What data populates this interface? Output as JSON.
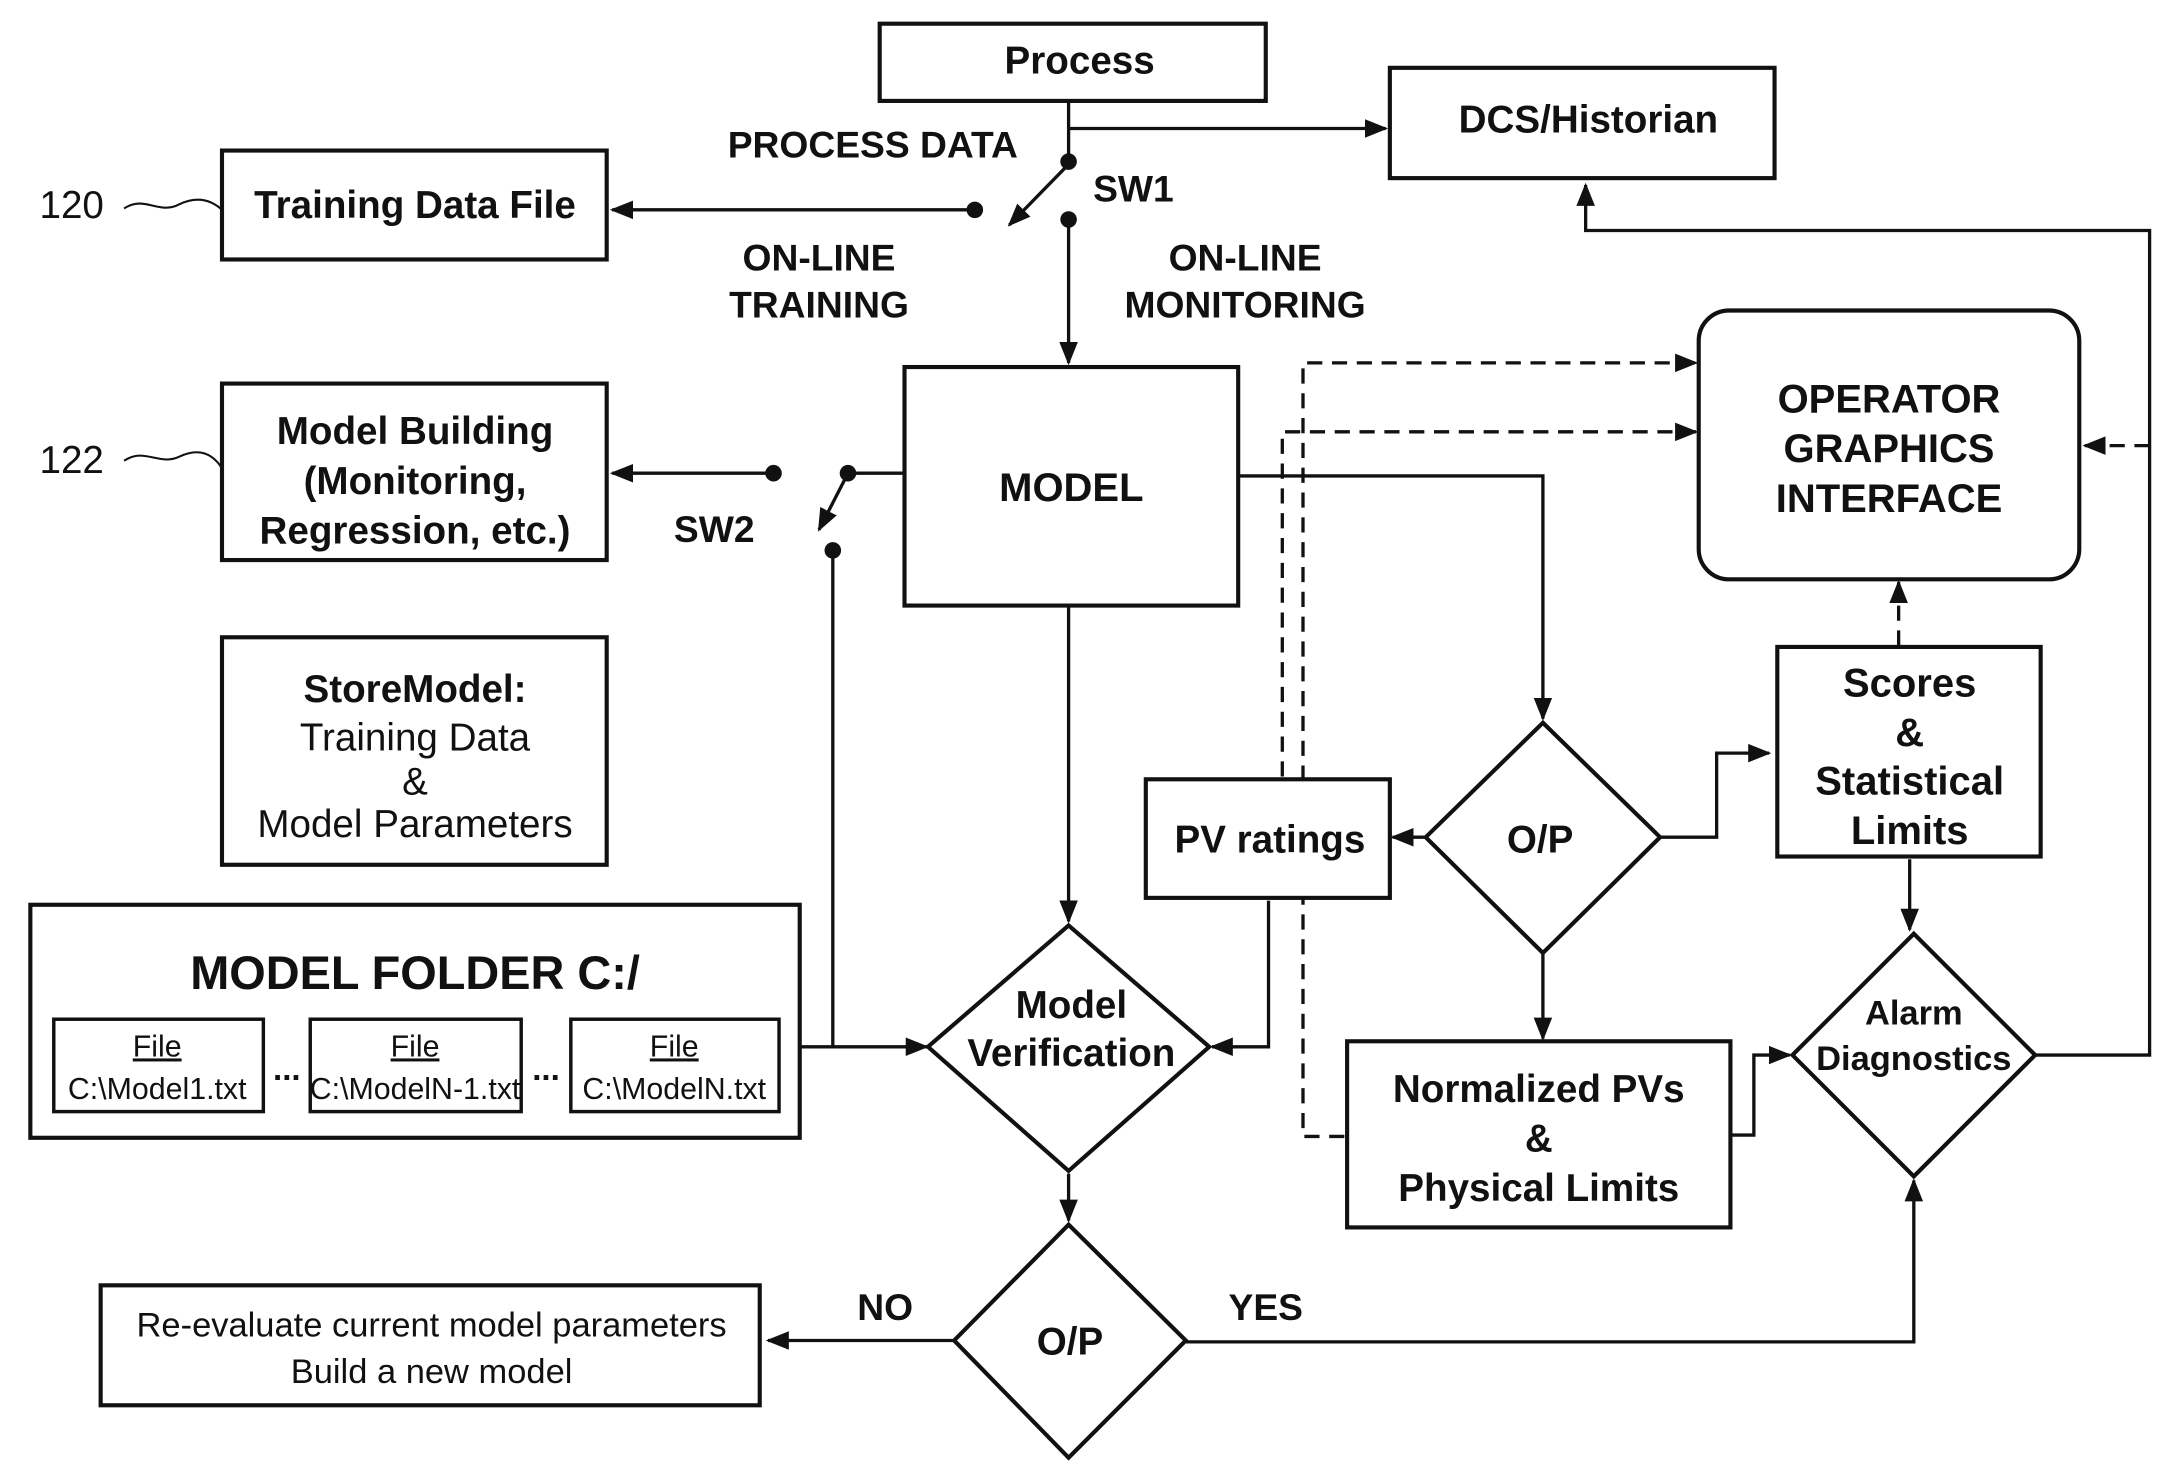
{
  "diagram": {
    "ref_labels": {
      "training_data_file": "120",
      "model_building": "122"
    },
    "process": "Process",
    "process_data_label": "PROCESS DATA",
    "dcs_historian": "DCS/Historian",
    "switch1": "SW1",
    "switch2": "SW2",
    "online_training": [
      "ON-LINE",
      "TRAINING"
    ],
    "online_monitoring": [
      "ON-LINE",
      "MONITORING"
    ],
    "training_data_file": "Training Data File",
    "model_building": [
      "Model Building",
      "(Monitoring,",
      "Regression, etc.)"
    ],
    "store_model": {
      "title": "StoreModel:",
      "lines": [
        "Training Data",
        "&",
        "Model Parameters"
      ]
    },
    "model": "MODEL",
    "operator_interface": [
      "OPERATOR",
      "GRAPHICS",
      "INTERFACE"
    ],
    "model_folder": {
      "title": "MODEL FOLDER C:/",
      "files": [
        {
          "label": "File",
          "path": "C:\\Model1.txt"
        },
        {
          "label": "File",
          "path": "C:\\ModelN-1.txt"
        },
        {
          "label": "File",
          "path": "C:\\ModelN.txt"
        }
      ],
      "ellipsis": "..."
    },
    "model_verification": [
      "Model",
      "Verification"
    ],
    "pv_ratings": "PV ratings",
    "op_decision_top": "O/P",
    "scores_limits": [
      "Scores",
      "&",
      "Statistical",
      "Limits"
    ],
    "normalized_pvs": [
      "Normalized PVs",
      "&",
      "Physical Limits"
    ],
    "alarm_diagnostics": [
      "Alarm",
      "Diagnostics"
    ],
    "op_decision_bottom": "O/P",
    "no_label": "NO",
    "yes_label": "YES",
    "reevaluate": [
      "Re-evaluate current model parameters",
      "Build a new model"
    ]
  }
}
